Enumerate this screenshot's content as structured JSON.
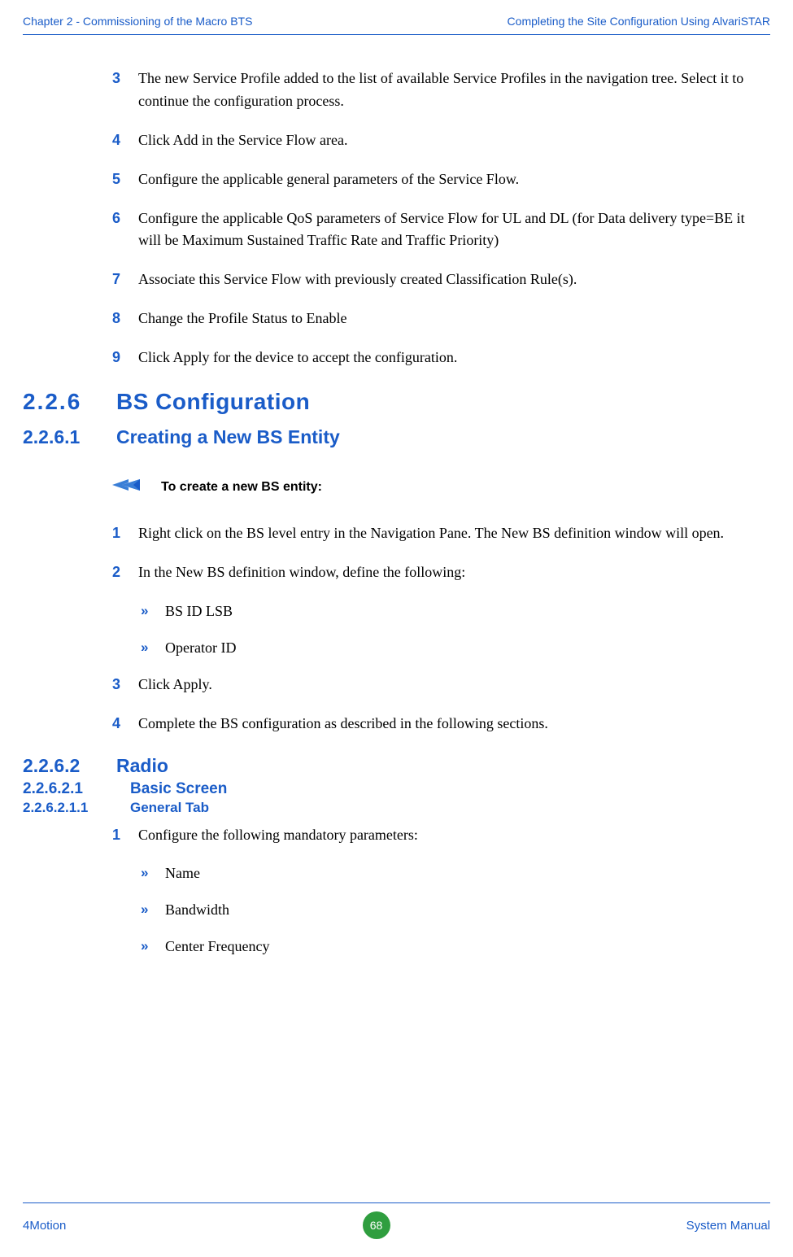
{
  "header": {
    "left": "Chapter 2 - Commissioning of the Macro BTS",
    "right": "Completing the Site Configuration Using AlvariSTAR"
  },
  "stepsA": [
    {
      "n": "3",
      "t": "The new Service Profile added to the list of available Service Profiles in the navigation tree. Select it to continue the configuration process."
    },
    {
      "n": "4",
      "t": "Click Add in the Service Flow area."
    },
    {
      "n": "5",
      "t": "Configure the applicable general parameters of the Service Flow."
    },
    {
      "n": "6",
      "t": "Configure the applicable QoS parameters of Service Flow for UL and DL (for Data delivery type=BE it will be Maximum Sustained Traffic Rate and Traffic Priority)"
    },
    {
      "n": "7",
      "t": "Associate this Service Flow with previously created Classification Rule(s)."
    },
    {
      "n": "8",
      "t": "Change the Profile Status to Enable"
    },
    {
      "n": "9",
      "t": "Click Apply for the device to accept the configuration."
    }
  ],
  "sec226": {
    "num": "2.2.6",
    "title": "BS Configuration"
  },
  "sec2261": {
    "num": "2.2.6.1",
    "title": "Creating a New BS Entity"
  },
  "callout": "To create a new BS entity:",
  "stepsB": [
    {
      "n": "1",
      "t": "Right click on the BS level entry in the Navigation Pane. The New BS definition window will open."
    },
    {
      "n": "2",
      "t": "In the New BS definition window, define the following:"
    }
  ],
  "subB": [
    "BS ID LSB",
    "Operator ID"
  ],
  "stepsB2": [
    {
      "n": "3",
      "t": "Click Apply."
    },
    {
      "n": "4",
      "t": "Complete the BS configuration as described in the following sections."
    }
  ],
  "sec2262": {
    "num": "2.2.6.2",
    "title": "Radio"
  },
  "sec22621": {
    "num": "2.2.6.2.1",
    "title": "Basic Screen"
  },
  "sec226211": {
    "num": "2.2.6.2.1.1",
    "title": "General Tab"
  },
  "stepsC": [
    {
      "n": "1",
      "t": "Configure the following mandatory parameters:"
    }
  ],
  "subC": [
    "Name",
    "Bandwidth",
    "Center Frequency"
  ],
  "footer": {
    "left": "4Motion",
    "page": "68",
    "right": "System Manual"
  },
  "bulletGlyph": "»"
}
